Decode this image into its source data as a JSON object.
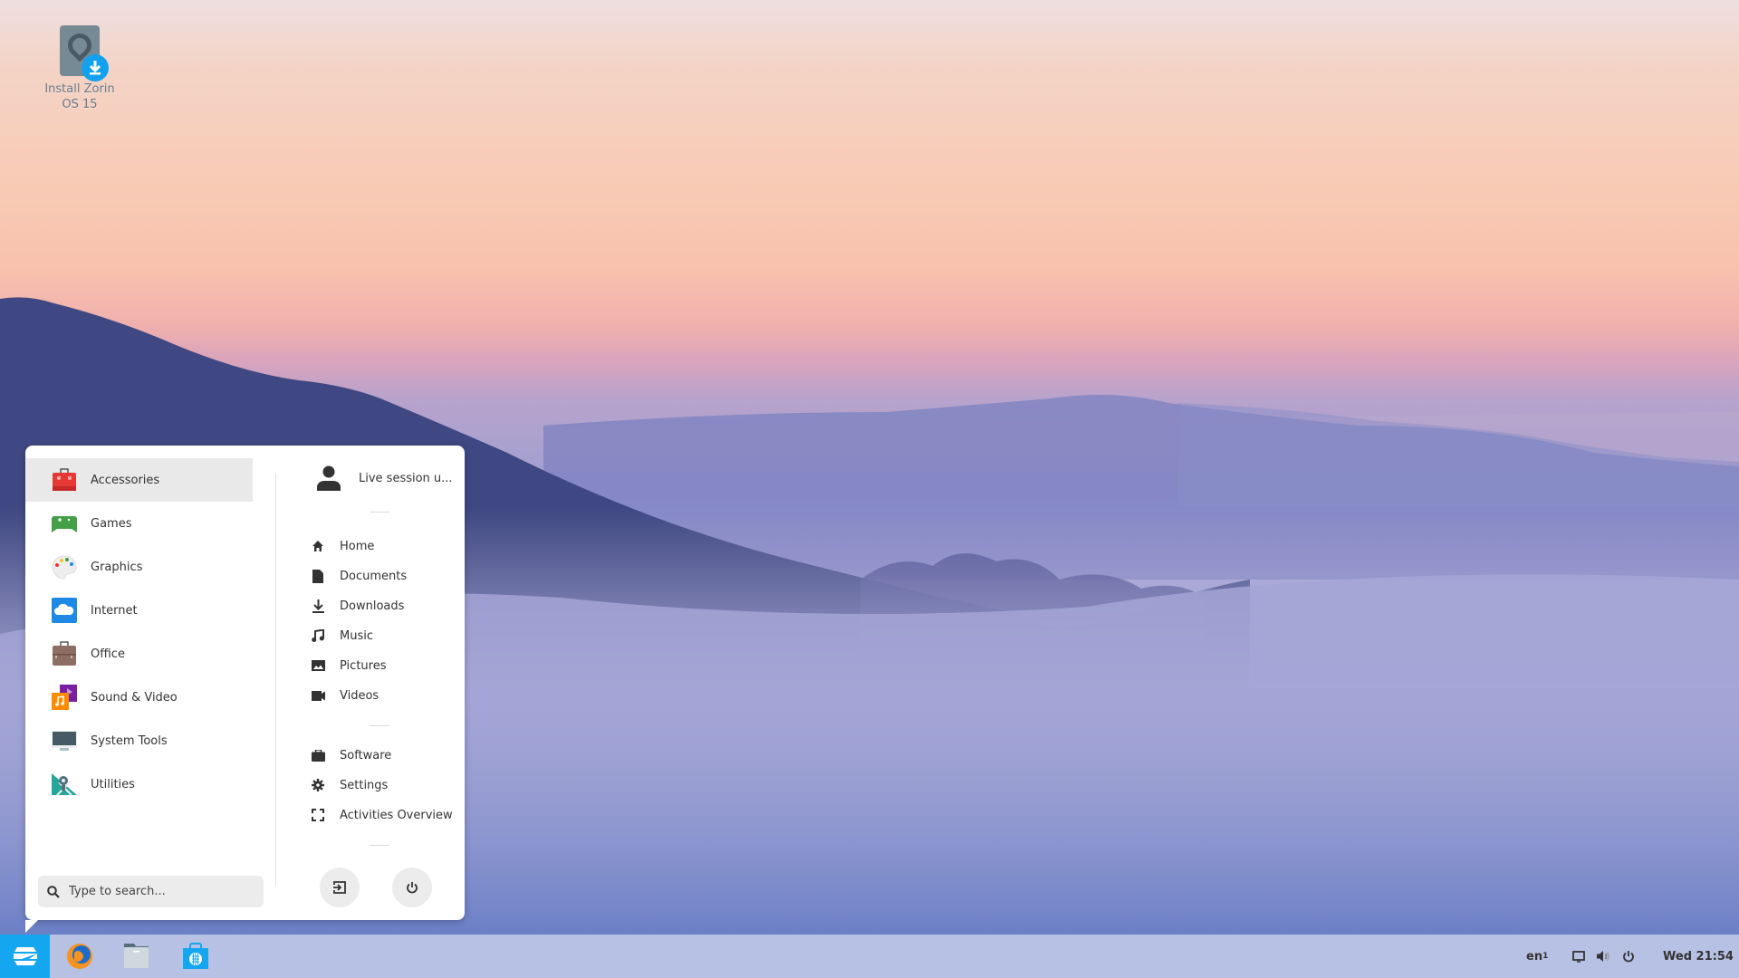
{
  "desktop": {
    "icons": [
      {
        "label": "Install Zorin OS 15",
        "icon": "install-drive-icon"
      }
    ]
  },
  "menu": {
    "categories": [
      {
        "label": "Accessories",
        "icon": "toolbox-icon",
        "color": "#e53935",
        "active": true
      },
      {
        "label": "Games",
        "icon": "gamepad-icon",
        "color": "#43a047"
      },
      {
        "label": "Graphics",
        "icon": "palette-icon",
        "color": "#eeeeee"
      },
      {
        "label": "Internet",
        "icon": "cloud-icon",
        "color": "#1e88e5"
      },
      {
        "label": "Office",
        "icon": "briefcase-icon",
        "color": "#8d6e63"
      },
      {
        "label": "Sound & Video",
        "icon": "media-icon",
        "color": "#7b1fa2"
      },
      {
        "label": "System Tools",
        "icon": "monitor-icon",
        "color": "#455a64"
      },
      {
        "label": "Utilities",
        "icon": "utilities-icon",
        "color": "#26a69a"
      }
    ],
    "search": {
      "placeholder": "Type to search...",
      "value": ""
    },
    "user": {
      "label": "Live session u...",
      "icon": "user-icon"
    },
    "places": [
      {
        "label": "Home",
        "icon": "home-icon"
      },
      {
        "label": "Documents",
        "icon": "document-icon"
      },
      {
        "label": "Downloads",
        "icon": "download-icon"
      },
      {
        "label": "Music",
        "icon": "music-icon"
      },
      {
        "label": "Pictures",
        "icon": "picture-icon"
      },
      {
        "label": "Videos",
        "icon": "video-icon"
      }
    ],
    "system": [
      {
        "label": "Software",
        "icon": "software-icon"
      },
      {
        "label": "Settings",
        "icon": "gear-icon"
      },
      {
        "label": "Activities Overview",
        "icon": "activities-icon"
      }
    ],
    "buttons": {
      "logout": "logout-icon",
      "power": "power-icon"
    }
  },
  "taskbar": {
    "start_button": "zorin-logo-icon",
    "apps": [
      {
        "name": "Firefox",
        "icon": "firefox-icon"
      },
      {
        "name": "Files",
        "icon": "files-icon"
      },
      {
        "name": "Software",
        "icon": "software-store-icon"
      }
    ],
    "tray": {
      "keyboard_layout": "en",
      "keyboard_layout_sub": "1",
      "clock": "Wed 21:54"
    },
    "accent_color": "#15a6f0"
  }
}
